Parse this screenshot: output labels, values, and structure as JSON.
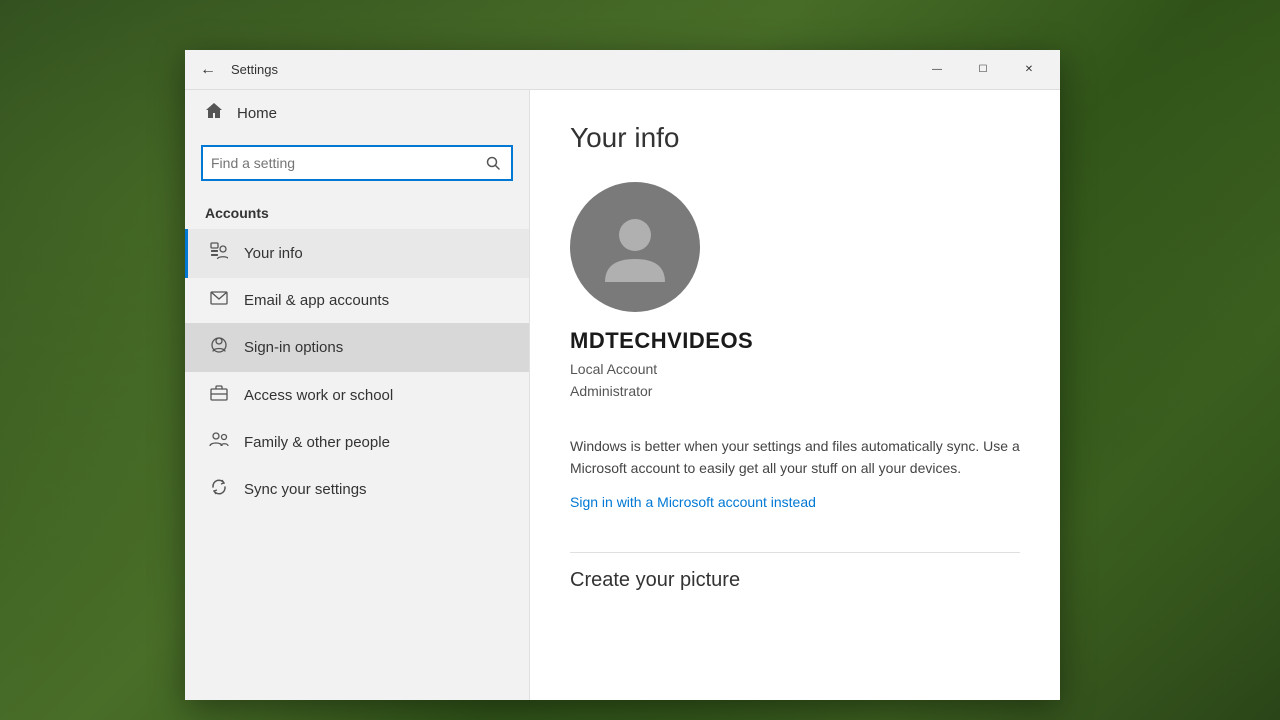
{
  "window": {
    "title": "Settings",
    "controls": {
      "minimize": "—",
      "maximize": "☐",
      "close": "✕"
    }
  },
  "sidebar": {
    "home_label": "Home",
    "search_placeholder": "Find a setting",
    "section_label": "Accounts",
    "nav_items": [
      {
        "id": "your-info",
        "label": "Your info",
        "icon": "person-card"
      },
      {
        "id": "email-app-accounts",
        "label": "Email & app accounts",
        "icon": "email"
      },
      {
        "id": "sign-in-options",
        "label": "Sign-in options",
        "icon": "fingerprint",
        "hovered": true
      },
      {
        "id": "access-work-school",
        "label": "Access work or school",
        "icon": "briefcase"
      },
      {
        "id": "family-other-people",
        "label": "Family & other people",
        "icon": "people"
      },
      {
        "id": "sync-your-settings",
        "label": "Sync your settings",
        "icon": "sync"
      }
    ]
  },
  "main": {
    "page_title": "Your info",
    "username": "MDTECHVIDEOS",
    "account_type_line1": "Local Account",
    "account_type_line2": "Administrator",
    "sync_description": "Windows is better when your settings and files automatically sync. Use a Microsoft account to easily get all your stuff on all your devices.",
    "ms_link_label": "Sign in with a Microsoft account instead",
    "create_picture_title": "Create your picture"
  }
}
